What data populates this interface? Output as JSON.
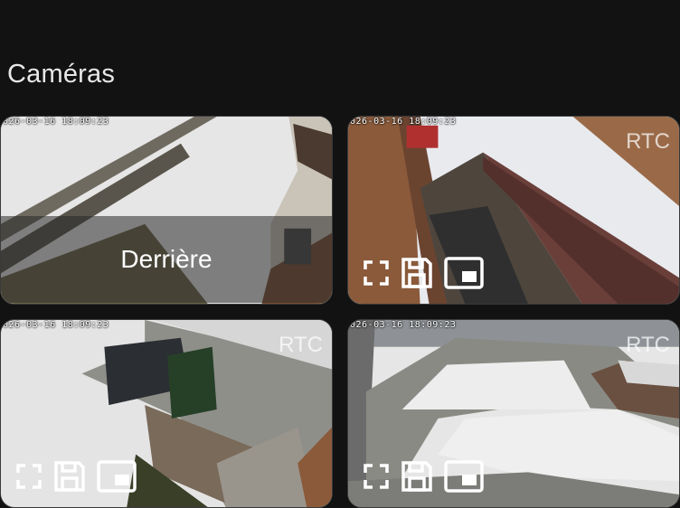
{
  "section": {
    "title": "Caméras"
  },
  "cameras": [
    {
      "timestamp": "026-03-16 18:09:23",
      "overlay_label": "Derrière",
      "badge": ""
    },
    {
      "timestamp": "026-03-16 18:09:23",
      "overlay_label": "",
      "badge": "RTC"
    },
    {
      "timestamp": "026-03-16 18:09:23",
      "overlay_label": "",
      "badge": "RTC"
    },
    {
      "timestamp": "026-03-16 18:09:23",
      "overlay_label": "",
      "badge": "RTC"
    }
  ],
  "controls": {
    "icons": [
      "fullscreen-icon",
      "save-icon",
      "picture-in-picture-icon"
    ]
  },
  "colors": {
    "background": "#121212",
    "snow": "#e9e9e9",
    "wood": "#8a5a3a"
  }
}
